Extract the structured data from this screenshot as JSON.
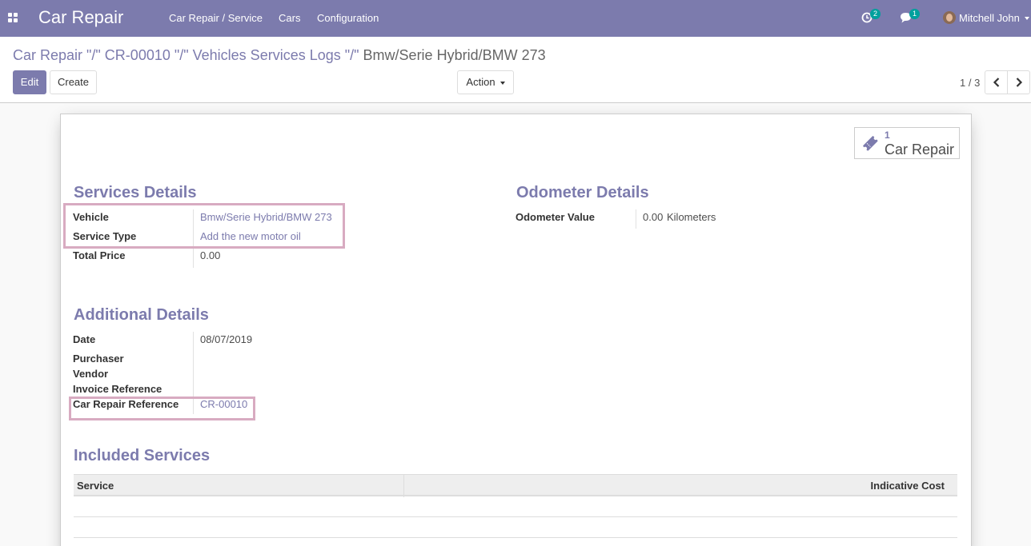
{
  "navbar": {
    "brand": "Car Repair",
    "menu": [
      "Car Repair / Service",
      "Cars",
      "Configuration"
    ],
    "activity_count": "2",
    "message_count": "1",
    "user_name": "Mitchell John"
  },
  "control_panel": {
    "breadcrumb": {
      "part1": "Car Repair \"/\" CR-00010 \"/\" Vehicles Services Logs \"/\"",
      "current": "Bmw/Serie Hybrid/BMW 273"
    },
    "edit_label": "Edit",
    "create_label": "Create",
    "action_label": "Action",
    "pager": "1 / 3"
  },
  "smart_button": {
    "count": "1",
    "label": "Car Repair"
  },
  "services_details": {
    "title": "Services Details",
    "vehicle_label": "Vehicle",
    "vehicle_value": "Bmw/Serie Hybrid/BMW 273",
    "service_type_label": "Service Type",
    "service_type_value": "Add the new motor oil",
    "total_price_label": "Total Price",
    "total_price_value": "0.00"
  },
  "odometer_details": {
    "title": "Odometer Details",
    "odometer_label": "Odometer Value",
    "odometer_value": "0.00",
    "odometer_unit": "Kilometers"
  },
  "additional_details": {
    "title": "Additional Details",
    "date_label": "Date",
    "date_value": "08/07/2019",
    "purchaser_label": "Purchaser",
    "vendor_label": "Vendor",
    "invoice_ref_label": "Invoice Reference",
    "car_repair_ref_label": "Car Repair Reference",
    "car_repair_ref_value": "CR-00010"
  },
  "included_services": {
    "title": "Included Services",
    "columns": [
      "Service",
      "Indicative Cost"
    ]
  },
  "colors": {
    "brand": "#7c7bad",
    "badge": "#00a09d",
    "highlight": "#d8abc1"
  }
}
